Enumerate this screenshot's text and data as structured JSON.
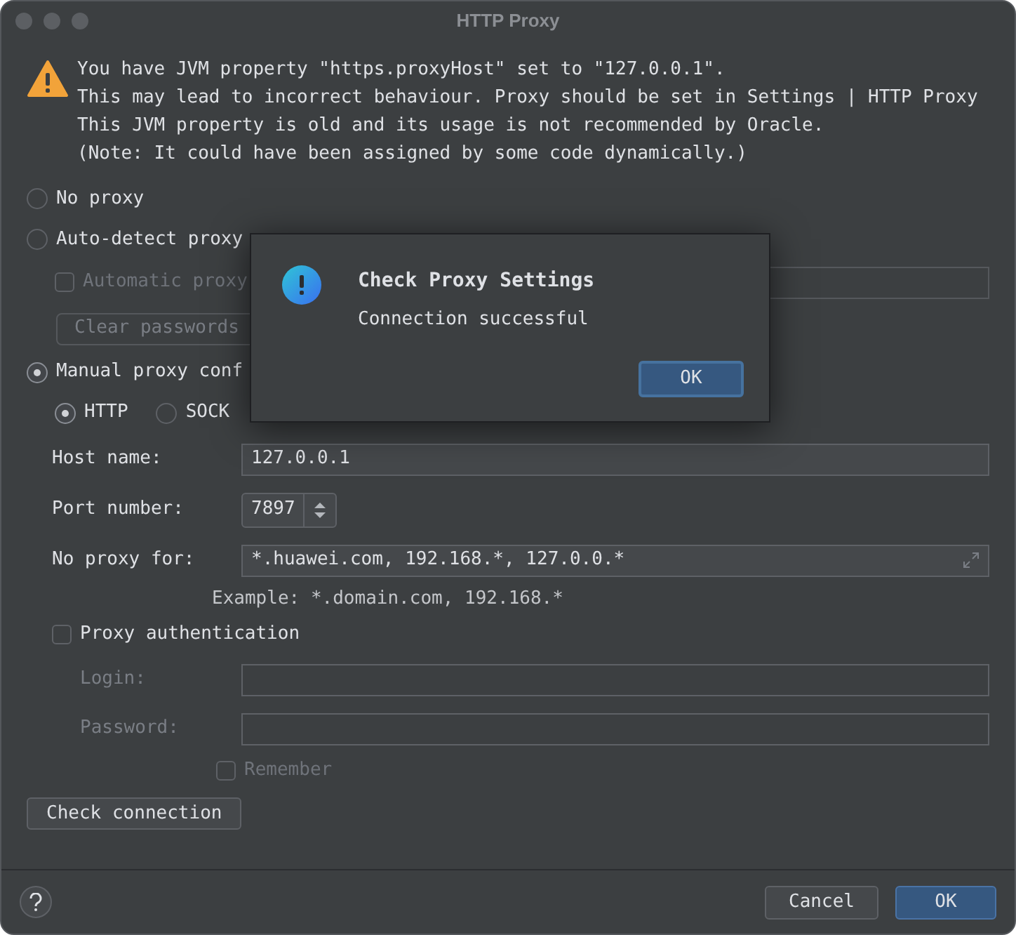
{
  "window": {
    "title": "HTTP Proxy"
  },
  "warning": {
    "lines": [
      "You have JVM property \"https.proxyHost\" set to \"127.0.0.1\".",
      "This may lead to incorrect behaviour. Proxy should be set in Settings | HTTP Proxy",
      "This JVM property is old and its usage is not recommended by Oracle.",
      "(Note: It could have been assigned by some code dynamically.)"
    ]
  },
  "proxy_modes": [
    {
      "label": "No proxy",
      "selected": false
    },
    {
      "label": "Auto-detect proxy",
      "selected": false
    },
    {
      "label": "Manual proxy conf",
      "selected": true
    }
  ],
  "automatic_proxy": {
    "label": "Automatic proxy",
    "checked": false
  },
  "clear_passwords": "Clear passwords",
  "protocols": [
    {
      "label": "HTTP",
      "selected": true
    },
    {
      "label": "SOCK",
      "selected": false
    }
  ],
  "host_name": {
    "label": "Host name:",
    "value": "127.0.0.1"
  },
  "port_number": {
    "label": "Port number:",
    "value": "7897"
  },
  "no_proxy_for": {
    "label": "No proxy for:",
    "value": "*.huawei.com, 192.168.*, 127.0.0.*"
  },
  "example": "Example: *.domain.com, 192.168.*",
  "proxy_authentication": {
    "label": "Proxy authentication",
    "checked": false
  },
  "login": {
    "label": "Login:"
  },
  "password": {
    "label": "Password:"
  },
  "remember": {
    "label": "Remember",
    "checked": false
  },
  "check_connection": "Check connection",
  "buttons": [
    {
      "label": "Cancel",
      "kind": "secondary"
    },
    {
      "label": "OK",
      "kind": "primary"
    }
  ],
  "popup": {
    "title": "Check Proxy Settings",
    "message": "Connection successful",
    "button": "OK"
  }
}
